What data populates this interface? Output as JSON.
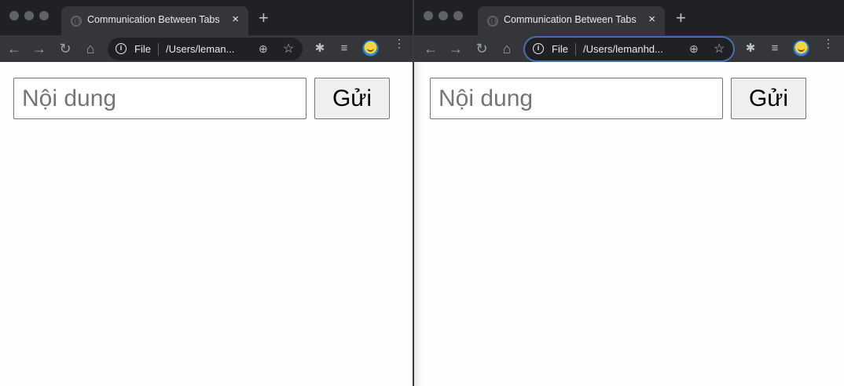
{
  "windows": [
    {
      "tab_title": "Communication Between Tabs",
      "address_scheme": "File",
      "address_url": "/Users/leman...",
      "input_placeholder": "Nội dung",
      "input_value": "",
      "send_label": "Gửi"
    },
    {
      "tab_title": "Communication Between Tabs",
      "address_scheme": "File",
      "address_url": "/Users/lemanhd...",
      "input_placeholder": "Nội dung",
      "input_value": "",
      "send_label": "Gửi"
    }
  ],
  "icons": {
    "tab_close": "×",
    "new_tab": "+",
    "back": "←",
    "forward": "→",
    "reload": "↻",
    "home": "⌂",
    "info": "i",
    "zoom": "⊕",
    "star": "☆",
    "extensions": "✱",
    "media": "≡",
    "menu": "⋮"
  },
  "colors": {
    "chrome_frame": "#202124",
    "toolbar": "#35363a",
    "omnibox_focus_ring": "#4d6cae"
  }
}
